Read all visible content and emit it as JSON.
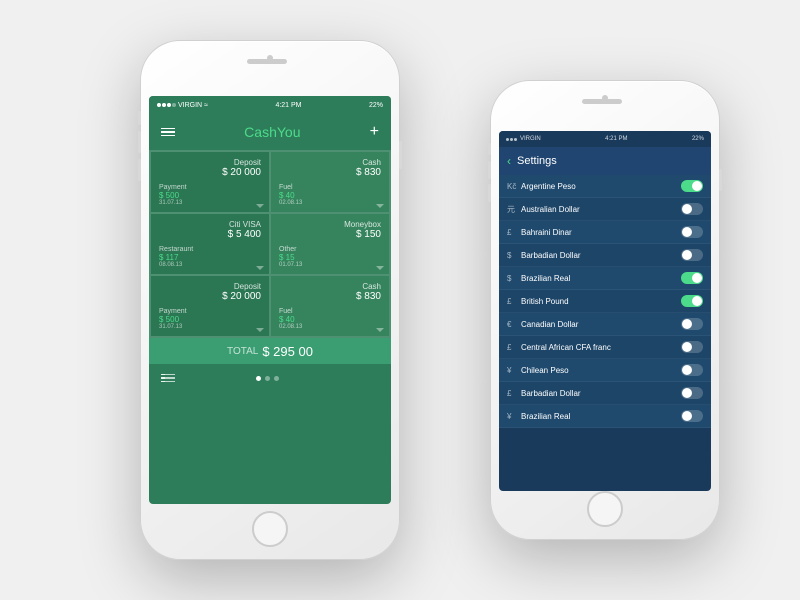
{
  "phones": {
    "main": {
      "status": {
        "carrier": "VIRGIN",
        "time": "4:21 PM",
        "battery": "22%"
      },
      "header": {
        "logo_regular": "Cash",
        "logo_accent": "You",
        "menu_label": "menu",
        "add_label": "add"
      },
      "cards": [
        {
          "title": "Deposit",
          "amount": "$ 20 000",
          "sub_label": "Payment",
          "sub_amount": "$ 500",
          "date": "31.07.13"
        },
        {
          "title": "Cash",
          "amount": "$ 830",
          "sub_label": "Fuel",
          "sub_amount": "$ 40",
          "date": "02.08.13"
        },
        {
          "title": "Citi VISA",
          "amount": "$ 5 400",
          "sub_label": "Restaraunt",
          "sub_amount": "$ 117",
          "date": "08.08.13"
        },
        {
          "title": "Moneybox",
          "amount": "$ 150",
          "sub_label": "Other",
          "sub_amount": "$ 15",
          "date": "01.07.13"
        },
        {
          "title": "Deposit",
          "amount": "$ 20 000",
          "sub_label": "Payment",
          "sub_amount": "$ 500",
          "date": "31.07.13"
        },
        {
          "title": "Cash",
          "amount": "$ 830",
          "sub_label": "Fuel",
          "sub_amount": "$ 40",
          "date": "02.08.13"
        }
      ],
      "total_label": "TOTAL",
      "total_amount": "$ 295 00"
    },
    "settings": {
      "status": {
        "carrier": "VIRGIN",
        "time": "4:21 PM",
        "battery": "22%"
      },
      "header": {
        "back_label": "‹",
        "title": "Settings"
      },
      "currencies": [
        {
          "symbol": "Kč",
          "name": "Argentine Peso",
          "on": true
        },
        {
          "symbol": "元",
          "name": "Australian Dollar",
          "on": false
        },
        {
          "symbol": "£",
          "name": "Bahraini Dinar",
          "on": false
        },
        {
          "symbol": "$",
          "name": "Barbadian Dollar",
          "on": false
        },
        {
          "symbol": "$",
          "name": "Brazilian Real",
          "on": true
        },
        {
          "symbol": "£",
          "name": "British Pound",
          "on": true
        },
        {
          "symbol": "€",
          "name": "Canadian Dollar",
          "on": false
        },
        {
          "symbol": "£",
          "name": "Central African CFA franc",
          "on": false
        },
        {
          "symbol": "¥",
          "name": "Chilean Peso",
          "on": false
        },
        {
          "symbol": "£",
          "name": "Barbadian Dollar",
          "on": false
        },
        {
          "symbol": "¥",
          "name": "Brazilian Real",
          "on": false
        }
      ]
    }
  }
}
